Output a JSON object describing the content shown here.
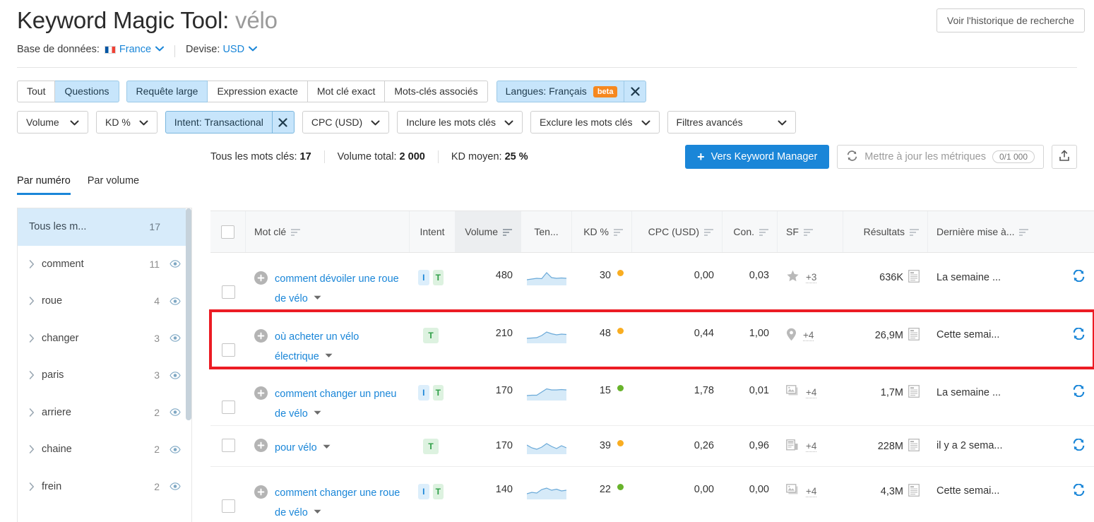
{
  "header": {
    "title_prefix": "Keyword Magic Tool:",
    "keyword": "vélo",
    "database_label": "Base de données:",
    "database_value": "France",
    "currency_label": "Devise:",
    "currency_value": "USD",
    "history_button": "Voir l'historique de recherche"
  },
  "filters": {
    "match_types": [
      {
        "label": "Tout",
        "active": false
      },
      {
        "label": "Questions",
        "active": true
      },
      {
        "label": "Requête large",
        "active": true
      },
      {
        "label": "Expression exacte",
        "active": false
      },
      {
        "label": "Mot clé exact",
        "active": false
      },
      {
        "label": "Mots-clés associés",
        "active": false
      }
    ],
    "language_chip": {
      "label": "Langues: Français",
      "badge": "beta"
    },
    "dropdowns": {
      "volume": "Volume",
      "kd": "KD %",
      "intent": "Intent: Transactional",
      "cpc": "CPC (USD)",
      "include": "Inclure les mots clés",
      "exclude": "Exclure les mots clés",
      "advanced": "Filtres avancés"
    }
  },
  "toolbar": {
    "all_keywords_label": "Tous les mots clés:",
    "all_keywords_value": "17",
    "total_volume_label": "Volume total:",
    "total_volume_value": "2 000",
    "avg_kd_label": "KD moyen:",
    "avg_kd_value": "25 %",
    "keyword_manager_button": "Vers Keyword Manager",
    "update_metrics_button": "Mettre à jour les métriques",
    "update_metrics_count": "0/1 000"
  },
  "sidebar": {
    "tabs": [
      {
        "label": "Par numéro",
        "active": true
      },
      {
        "label": "Par volume",
        "active": false
      }
    ],
    "items": [
      {
        "label": "Tous les m...",
        "count": "17",
        "selected": true,
        "has_eye": false
      },
      {
        "label": "comment",
        "count": "11",
        "selected": false,
        "has_eye": true
      },
      {
        "label": "roue",
        "count": "4",
        "selected": false,
        "has_eye": true
      },
      {
        "label": "changer",
        "count": "3",
        "selected": false,
        "has_eye": true
      },
      {
        "label": "paris",
        "count": "3",
        "selected": false,
        "has_eye": true
      },
      {
        "label": "arriere",
        "count": "2",
        "selected": false,
        "has_eye": true
      },
      {
        "label": "chaine",
        "count": "2",
        "selected": false,
        "has_eye": true
      },
      {
        "label": "frein",
        "count": "2",
        "selected": false,
        "has_eye": true
      }
    ]
  },
  "table": {
    "columns": [
      {
        "key": "checkbox",
        "label": "",
        "sortable": false,
        "highlight": false
      },
      {
        "key": "keyword",
        "label": "Mot clé",
        "sortable": true,
        "highlight": false
      },
      {
        "key": "intent",
        "label": "Intent",
        "sortable": false,
        "highlight": false
      },
      {
        "key": "volume",
        "label": "Volume",
        "sortable": true,
        "highlight": true
      },
      {
        "key": "trend",
        "label": "Ten...",
        "sortable": false,
        "highlight": false
      },
      {
        "key": "kd",
        "label": "KD %",
        "sortable": true,
        "highlight": false
      },
      {
        "key": "cpc",
        "label": "CPC (USD)",
        "sortable": true,
        "highlight": false
      },
      {
        "key": "con",
        "label": "Con.",
        "sortable": true,
        "highlight": false
      },
      {
        "key": "sf",
        "label": "SF",
        "sortable": true,
        "highlight": false
      },
      {
        "key": "results",
        "label": "Résultats",
        "sortable": true,
        "highlight": false
      },
      {
        "key": "updated",
        "label": "Dernière mise à...",
        "sortable": true,
        "highlight": false
      }
    ],
    "rows": [
      {
        "keyword": "comment dévoiler une roue de vélo",
        "intents": [
          "I",
          "T"
        ],
        "volume": "480",
        "kd": "30",
        "kd_color": "#f9ad21",
        "cpc": "0,00",
        "con": "0,03",
        "sf_icon": "star-icon",
        "sf_count": "+3",
        "results": "636K",
        "updated": "La semaine ...",
        "highlighted": false
      },
      {
        "keyword": "où acheter un vélo électrique",
        "intents": [
          "T"
        ],
        "volume": "210",
        "kd": "48",
        "kd_color": "#f9ad21",
        "cpc": "0,44",
        "con": "1,00",
        "sf_icon": "map-pin-icon",
        "sf_count": "+4",
        "results": "26,9M",
        "updated": "Cette semai...",
        "highlighted": true
      },
      {
        "keyword": "comment changer un pneu de vélo",
        "intents": [
          "I",
          "T"
        ],
        "volume": "170",
        "kd": "15",
        "kd_color": "#68b32b",
        "cpc": "1,78",
        "con": "0,01",
        "sf_icon": "image-pack-icon",
        "sf_count": "+4",
        "results": "1,7M",
        "updated": "La semaine ...",
        "highlighted": false
      },
      {
        "keyword": "pour vélo",
        "intents": [
          "T"
        ],
        "volume": "170",
        "kd": "39",
        "kd_color": "#f9ad21",
        "cpc": "0,26",
        "con": "0,96",
        "sf_icon": "news-icon",
        "sf_count": "+4",
        "results": "228M",
        "updated": "il y a 2 sema...",
        "highlighted": false
      },
      {
        "keyword": "comment changer une roue de vélo",
        "intents": [
          "I",
          "T"
        ],
        "volume": "140",
        "kd": "22",
        "kd_color": "#68b32b",
        "cpc": "0,00",
        "con": "0,00",
        "sf_icon": "image-pack-icon",
        "sf_count": "+4",
        "results": "4,3M",
        "updated": "Cette semai...",
        "highlighted": false
      }
    ]
  },
  "colors": {
    "accent": "#1a86d8",
    "highlight_border": "#ec1c24",
    "beta_badge": "#f6881f",
    "kd_easy": "#68b32b",
    "kd_medium": "#f9ad21"
  }
}
